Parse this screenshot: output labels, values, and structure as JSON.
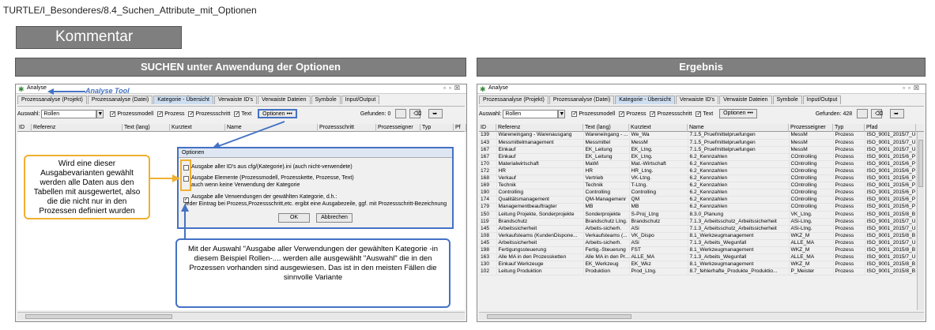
{
  "breadcrumb": "TURTLE/I_Besonderes/8.4_Suchen_Attribute_mit_Optionen",
  "comment_label": "Kommentar",
  "left_bar": "SUCHEN unter Anwendung der Optionen",
  "right_bar": "Ergebnis",
  "window": {
    "title": "Analyse",
    "tool_label": "Analyse Tool",
    "tabs": [
      "Prozessanalyse (Projekt)",
      "Prozessanalyse (Datei)",
      "Kategorie - Übersicht",
      "Verwaiste ID's",
      "Verwaiste Dateien",
      "Symbole",
      "Input/Output"
    ],
    "auswahl_label": "Auswahl:",
    "auswahl_value": "Rollen",
    "checkboxes": [
      "Prozessmodell",
      "Prozess",
      "Prozessschritt",
      "Text"
    ],
    "options_button": "Optionen •••",
    "gefunden_left": "Gefunden: 0",
    "gefunden_right": "Gefunden: 428"
  },
  "left_columns": [
    "ID",
    "Referenz",
    "Text (lang)",
    "Kurztext",
    "Name",
    "Prozessschritt",
    "Prozesseigner",
    "Typ",
    "Pf"
  ],
  "right_columns": [
    "ID",
    "Referenz",
    "Text (lang)",
    "Kurztext",
    "Name",
    "Prozesseigner",
    "Typ",
    "Pfad"
  ],
  "dialog": {
    "title": "Optionen",
    "opt1": "Ausgabe aller ID's aus cfg/(Kategorie).ini (auch nicht-verwendete)",
    "opt2a": "Ausgabe Elemente (Prozessmodell, Prozesskette, Prozesse, Text)",
    "opt2b": "auch wenn keine Verwendung der Kategorie",
    "opt3a": "Ausgabe alle Verwendungen der gewählten Kategorie, d.h.:",
    "opt3b": "jeder Eintrag bei Prozess,Prozessschritt,etc. ergibt eine Ausgabezeile, ggf. mit Prozessschritt-Bezeichnung",
    "ok": "OK",
    "cancel": "Abbrechen"
  },
  "callout_yellow": "Wird eine dieser Ausgabevarianten gewählt werden alle Daten aus den Tabellen mit ausgewertet, also die die nicht nur in den Prozessen definiert wurden",
  "callout_blue": "Mit der Auswahl \"Ausgabe aller Verwendungen der gewählten Kategorie -in diesem Beispiel Rollen-.... werden alle ausgewählt \"Auswahl\" die in den Prozessen vorhanden sind ausgewiesen. Das ist in den meisten Fällen die sinnvolle Variante",
  "rows": [
    [
      "139",
      "Wareneingang - Warenausgang",
      "Wareneingang - ...",
      "We_Wa",
      "7.1.5_Pruefmittelpruefungen",
      "MessM",
      "Prozess",
      "ISO_9001_2015/7_U"
    ],
    [
      "143",
      "Messmittelmanagement",
      "Messmittel",
      "MessM",
      "7.1.5_Pruefmittelpruefungen",
      "MessM",
      "Prozess",
      "ISO_9001_2015/7_U"
    ],
    [
      "167",
      "Einkauf",
      "EK_Leitung",
      "EK_Ltng.",
      "7.1.5_Pruefmittelpruefungen",
      "MessM",
      "Prozess",
      "ISO_9001_2015/7_U"
    ],
    [
      "167",
      "Einkauf",
      "EK_Leitung",
      "EK_Ltng.",
      "6.2_Kennzahlen",
      "COntrolling",
      "Prozess",
      "ISO_9001_2015/6_P"
    ],
    [
      "170",
      "Materialwirtschaft",
      "MaWi",
      "Mat.-Wirtschaft",
      "6.2_Kennzahlen",
      "COntrolling",
      "Prozess",
      "ISO_9001_2015/6_P"
    ],
    [
      "172",
      "HR",
      "HR",
      "HR_Ltng.",
      "6.2_Kennzahlen",
      "COntrolling",
      "Prozess",
      "ISO_9001_2015/6_P"
    ],
    [
      "168",
      "Verkauf",
      "Vertrieb",
      "VK-Ltng.",
      "6.2_Kennzahlen",
      "COntrolling",
      "Prozess",
      "ISO_9001_2015/6_P"
    ],
    [
      "169",
      "Technik",
      "Technik",
      "T-Ltng.",
      "6.2_Kennzahlen",
      "COntrolling",
      "Prozess",
      "ISO_9001_2015/6_P"
    ],
    [
      "190",
      "Controlling",
      "Controlling",
      "Controlling",
      "6.2_Kennzahlen",
      "COntrolling",
      "Prozess",
      "ISO_9001_2015/6_P"
    ],
    [
      "174",
      "Qualitätsmanagement",
      "QM-Managemenr",
      "QM",
      "6.2_Kennzahlen",
      "COntrolling",
      "Prozess",
      "ISO_9001_2015/6_P"
    ],
    [
      "179",
      "Managementbeauftragter",
      "MB",
      "MB",
      "6.2_Kennzahlen",
      "COntrolling",
      "Prozess",
      "ISO_9001_2015/6_P"
    ],
    [
      "150",
      "Leitung Projekte, Sonderprojekte",
      "Sonderprojekte",
      "S-Proj_Ltng",
      "8.3.0_Planung",
      "VK_Ltng.",
      "Prozess",
      "ISO_9001_2015/8_B"
    ],
    [
      "119",
      "Brandschutz",
      "Brandschutz Ltng.",
      "Brandschutz",
      "7.1.3_Arbeitsschutz_Arbeitssicherheit",
      "ASi-Ltng.",
      "Prozess",
      "ISO_9001_2015/7_U"
    ],
    [
      "145",
      "Arbeitssicherheit",
      "Arbeits-sicherh.",
      "ASi",
      "7.1.3_Arbeitsschutz_Arbeitssicherheit",
      "ASi-Ltng.",
      "Prozess",
      "ISO_9001_2015/7_U"
    ],
    [
      "108",
      "Verkaufsteams (KundenDispone...",
      "Verkaufsteams (...",
      "VK_Dispo",
      "8.1_Werkzeugmanagement",
      "WKZ_M",
      "Prozess",
      "ISO_9001_2015/8_B"
    ],
    [
      "145",
      "Arbeitssicherheit",
      "Arbeits-sicherh.",
      "ASi",
      "7.1.3_Arbeits_Wegunfall",
      "ALLE_MA",
      "Prozess",
      "ISO_9001_2015/7_U"
    ],
    [
      "198",
      "Fertigungssteuerung",
      "Fertig.-Steuerung",
      "FST",
      "8.1_Werkzeugmanagement",
      "WKZ_M",
      "Prozess",
      "ISO_9001_2015/8_B"
    ],
    [
      "163",
      "Alle MA in den Prozessketten",
      "Alle MA in den Pr...",
      "ALLE_MA",
      "7.1.3_Arbeits_Wegunfall",
      "ALLE_MA",
      "Prozess",
      "ISO_9001_2015/7_U"
    ],
    [
      "130",
      "Einkauf Werkzeuge",
      "EK_Werkzeug",
      "EK_Wkz",
      "8.1_Werkzeugmanagement",
      "WKZ_M",
      "Prozess",
      "ISO_9001_2015/8_B"
    ],
    [
      "102",
      "Leitung Produktion",
      "Produktion",
      "Prod_Ltng.",
      "8.7_fehlerhafte_Produkte_Produktio...",
      "P_Meister",
      "Prozess",
      "ISO_9001_2015/8_B"
    ]
  ]
}
